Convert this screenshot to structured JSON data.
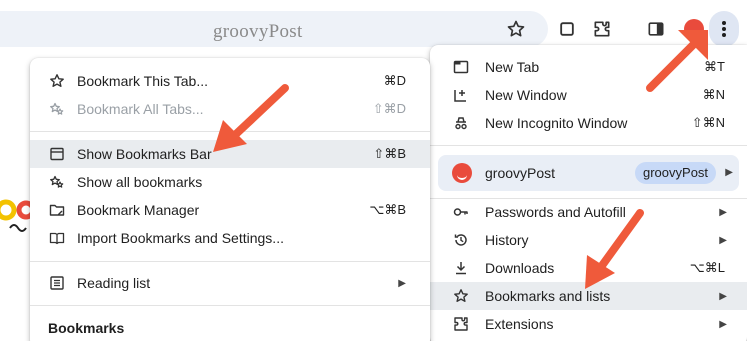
{
  "watermark": "groovyPost",
  "toolbar": {
    "icons": [
      "star-icon",
      "square-icon",
      "extension-icon",
      "side-panel-icon",
      "avatar",
      "kebab-menu-icon"
    ]
  },
  "main_menu": {
    "items": [
      {
        "label": "New Tab",
        "shortcut": "⌘T",
        "icon": "new-tab-icon"
      },
      {
        "label": "New Window",
        "shortcut": "⌘N",
        "icon": "new-window-icon"
      },
      {
        "label": "New Incognito Window",
        "shortcut": "⇧⌘N",
        "icon": "incognito-icon"
      }
    ],
    "profile": {
      "label": "groovyPost",
      "chip": "groovyPost"
    },
    "items2": [
      {
        "label": "Passwords and Autofill",
        "icon": "key-icon"
      },
      {
        "label": "History",
        "icon": "history-icon"
      },
      {
        "label": "Downloads",
        "shortcut": "⌥⌘L",
        "icon": "download-icon"
      },
      {
        "label": "Bookmarks and lists",
        "icon": "star-icon"
      },
      {
        "label": "Extensions",
        "icon": "puzzle-icon"
      }
    ]
  },
  "bookmarks_menu": {
    "items": [
      {
        "label": "Bookmark This Tab...",
        "shortcut": "⌘D"
      },
      {
        "label": "Bookmark All Tabs...",
        "shortcut": "⇧⌘D"
      },
      {
        "label": "Show Bookmarks Bar",
        "shortcut": "⇧⌘B"
      },
      {
        "label": "Show all bookmarks"
      },
      {
        "label": "Bookmark Manager",
        "shortcut": "⌥⌘B"
      },
      {
        "label": "Import Bookmarks and Settings..."
      },
      {
        "label": "Reading list"
      }
    ],
    "section_title": "Bookmarks"
  },
  "colors": {
    "arrow": "#ef5a3b",
    "highlight": "#e9ecef",
    "profile_bg": "#e9eef6",
    "chip_bg": "#c7d9f7"
  }
}
